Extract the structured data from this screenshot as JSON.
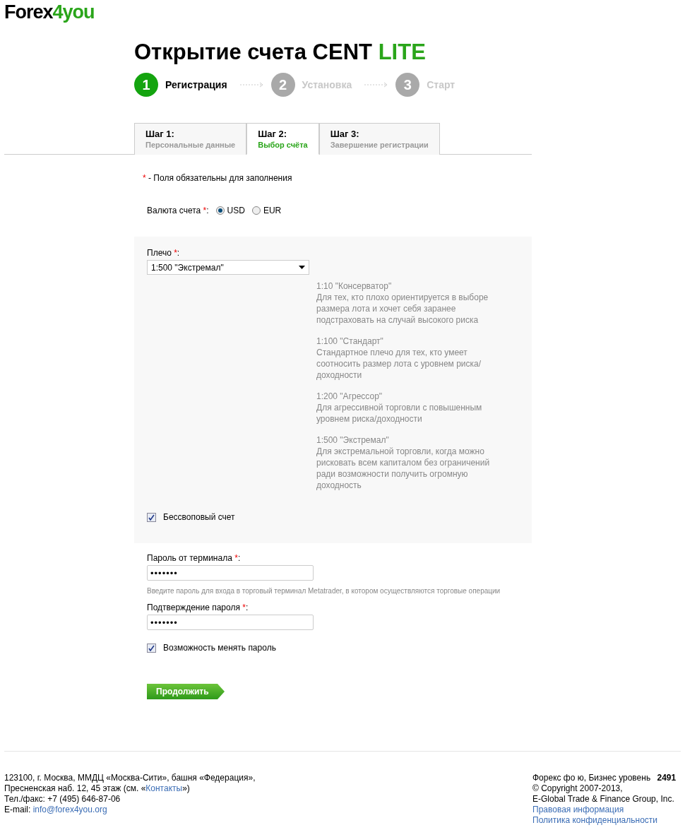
{
  "logo": {
    "part_1": "Forex",
    "part_2": "4you"
  },
  "title": {
    "main": "Открытие счета CENT",
    "accent": "LITE"
  },
  "steps": [
    {
      "number": "1",
      "label": "Регистрация",
      "selected": true
    },
    {
      "number": "2",
      "label": "Установка",
      "selected": false
    },
    {
      "number": "3",
      "label": "Старт",
      "selected": false
    }
  ],
  "tabs": [
    {
      "title": "Шаг 1:",
      "subtitle": "Персональные данные",
      "selected": false
    },
    {
      "title": "Шаг 2:",
      "subtitle": "Выбор счёта",
      "selected": true
    },
    {
      "title": "Шаг 3:",
      "subtitle": "Завершение регистрации",
      "selected": false
    }
  ],
  "required_note": {
    "mark": "*",
    "text": "- Поля обязательны для заполнения"
  },
  "currency": {
    "label": "Валюта счета",
    "mark": "*",
    "colon": ":",
    "options": [
      {
        "label": "USD",
        "selected": true
      },
      {
        "label": "EUR",
        "selected": false
      }
    ]
  },
  "leverage": {
    "label": "Плечо",
    "mark": "*",
    "colon": ":",
    "value": "1:500 \"Экстремал\"",
    "descriptions": [
      {
        "title": "1:10 \"Консерватор\"",
        "text": "Для тех, кто плохо ориентируется в выборе размера лота и хочет себя заранее подстраховать на случай высокого риска"
      },
      {
        "title": "1:100 \"Стандарт\"",
        "text": "Стандартное плечо для тех, кто умеет соотносить размер лота с уровнем риска/доходности"
      },
      {
        "title": "1:200 \"Агрессор\"",
        "text": "Для агрессивной торговли с повышенным уровнем риска/доходности"
      },
      {
        "title": "1:500 \"Экстремал\"",
        "text": "Для экстремальной торговли, когда можно рисковать всем капиталом без ограничений ради возможности получить огромную доходность"
      }
    ],
    "swap_free": {
      "label": "Бессвоповый счет",
      "checked": true
    }
  },
  "password": {
    "label": "Пароль от терминала",
    "mark": "*",
    "colon": ":",
    "value": "•••••••",
    "hint": "Введите пароль для входа в торговый терминал Metatrader, в котором осуществляются торговые операции"
  },
  "confirm": {
    "label": "Подтверждение пароля",
    "mark": "*",
    "colon": ":",
    "value": "•••••••"
  },
  "change_password": {
    "label": "Возможность менять пароль",
    "checked": true
  },
  "continue_button": "Продолжить",
  "footer": {
    "address_1": "123100, г. Москва, ММДЦ «Москва-Сити», башня «Федерация»,",
    "address_2_before": "Пресненская наб. 12, 45 этаж (см. «",
    "address_2_link": "Контакты",
    "address_2_after": "»)",
    "phone": "Тел./факс: +7 (495) 646-87-06",
    "email_label": "E-mail:",
    "email": "info@forex4you.org",
    "brand": "Форекс фо ю, Бизнес уровень",
    "counter": "2491",
    "copyright": "© Copyright 2007-2013,",
    "company": "E-Global Trade & Finance Group, Inc.",
    "links": [
      "Правовая информация",
      "Политика конфиденциальности"
    ]
  }
}
